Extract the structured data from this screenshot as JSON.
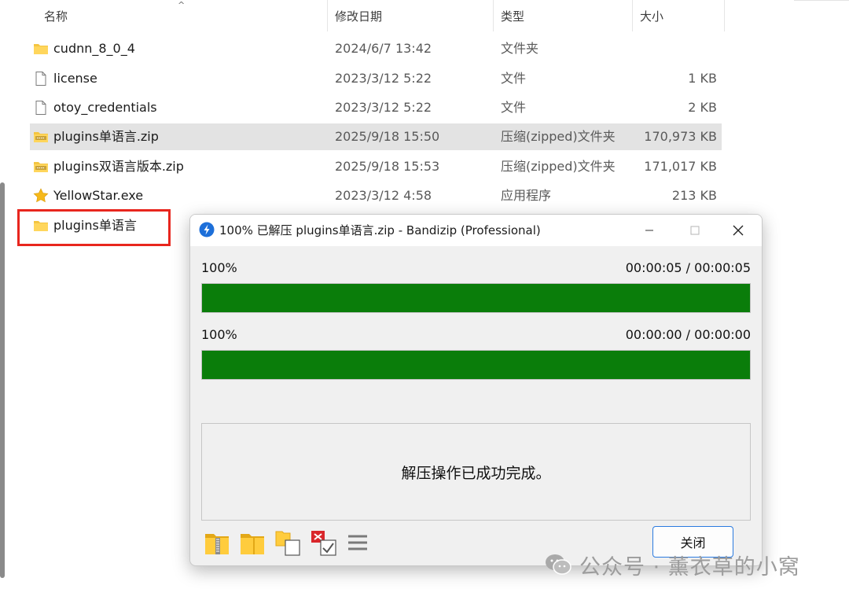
{
  "explorer": {
    "columns": {
      "name": "名称",
      "modified": "修改日期",
      "type": "类型",
      "size": "大小"
    },
    "files": [
      {
        "name": "cudnn_8_0_4",
        "modified": "2024/6/7 13:42",
        "type": "文件夹",
        "size": "",
        "icon": "folder-icon"
      },
      {
        "name": "license",
        "modified": "2023/3/12 5:22",
        "type": "文件",
        "size": "1 KB",
        "icon": "file-icon"
      },
      {
        "name": "otoy_credentials",
        "modified": "2023/3/12 5:22",
        "type": "文件",
        "size": "2 KB",
        "icon": "file-icon"
      },
      {
        "name": "plugins单语言.zip",
        "modified": "2025/9/18 15:50",
        "type": "压缩(zipped)文件夹",
        "size": "170,973 KB",
        "icon": "zip-folder-icon",
        "selected": true
      },
      {
        "name": "plugins双语言版本.zip",
        "modified": "2025/9/18 15:53",
        "type": "压缩(zipped)文件夹",
        "size": "171,017 KB",
        "icon": "zip-folder-icon"
      },
      {
        "name": "YellowStar.exe",
        "modified": "2023/3/12 4:58",
        "type": "应用程序",
        "size": "213 KB",
        "icon": "star-app-icon"
      },
      {
        "name": "plugins单语言",
        "modified": "",
        "type": "",
        "size": "",
        "icon": "folder-icon",
        "highlighted": true
      }
    ],
    "highlight_color": "#e8261e",
    "selected_row_color": "#e3e3e3"
  },
  "dialog": {
    "title": "100% 已解压 plugins单语言.zip - Bandizip (Professional)",
    "progress1": {
      "percent_label": "100%",
      "time": "00:00:05 / 00:00:05",
      "value": 1.0
    },
    "progress2": {
      "percent_label": "100%",
      "time": "00:00:00 / 00:00:00",
      "value": 1.0
    },
    "message": "解压操作已成功完成。",
    "close_label": "关闭",
    "toolbar_icons": [
      "zip-folder-open-icon",
      "folder-open-icon",
      "copy-to-folder-icon",
      "delete-archive-icon",
      "menu-icon"
    ],
    "bar_color": "#0a7d0a"
  },
  "watermark": {
    "text": "公众号 · 薰衣草的小窝"
  }
}
